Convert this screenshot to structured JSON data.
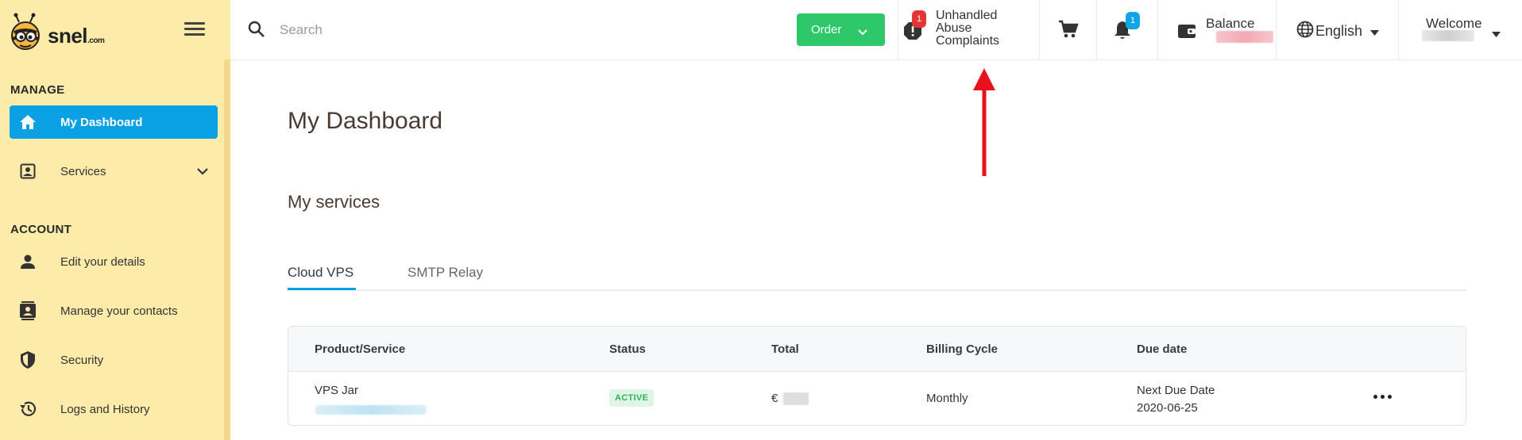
{
  "brand": {
    "name": "snel",
    "tld": ".com"
  },
  "sidebar": {
    "sections": [
      {
        "title": "MANAGE"
      },
      {
        "title": "ACCOUNT"
      }
    ],
    "items": [
      {
        "label": "My Dashboard",
        "icon": "home-icon",
        "active": true
      },
      {
        "label": "Services",
        "icon": "id-card-icon",
        "expandable": true
      },
      {
        "label": "Edit your details",
        "icon": "person-icon"
      },
      {
        "label": "Manage your contacts",
        "icon": "contacts-icon"
      },
      {
        "label": "Security",
        "icon": "shield-icon"
      },
      {
        "label": "Logs and History",
        "icon": "history-icon"
      }
    ]
  },
  "topbar": {
    "search": {
      "placeholder": "Search",
      "value": ""
    },
    "order_label": "Order",
    "abuse": {
      "count": "1",
      "line1": "Unhandled",
      "line2": "Abuse",
      "line3": "Complaints"
    },
    "notifications_count": "1",
    "balance_label": "Balance",
    "language": "English",
    "welcome": "Welcome"
  },
  "main": {
    "title": "My Dashboard",
    "services_title": "My services",
    "tabs": [
      {
        "label": "Cloud VPS",
        "active": true
      },
      {
        "label": "SMTP Relay",
        "active": false
      }
    ],
    "table": {
      "headers": [
        "Product/Service",
        "Status",
        "Total",
        "Billing Cycle",
        "Due date"
      ],
      "rows": [
        {
          "product": "VPS Jar",
          "status": "ACTIVE",
          "currency": "€",
          "billing_cycle": "Monthly",
          "due_label": "Next Due Date",
          "due_date": "2020-06-25"
        }
      ]
    }
  },
  "colors": {
    "sidebar_bg": "#fdebaa",
    "accent_blue": "#0aa0e4",
    "order_green": "#2ec76a",
    "badge_red": "#e53535",
    "annotation_red": "#e8121c"
  }
}
